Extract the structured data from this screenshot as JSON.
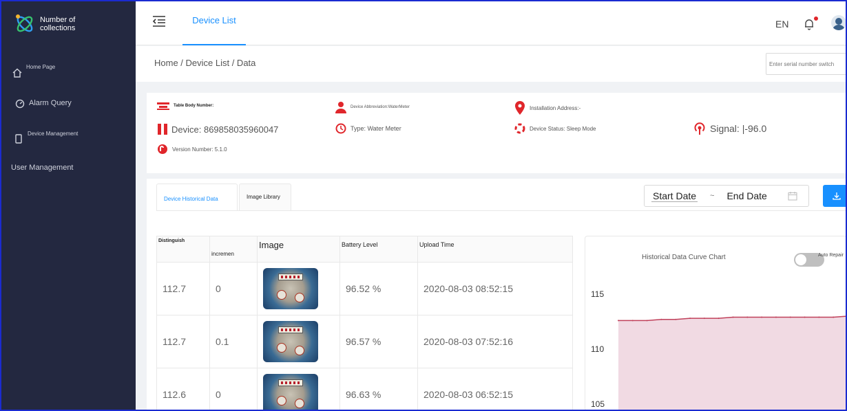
{
  "sidebar": {
    "brand": "Number of collections",
    "items": [
      {
        "label": "Home Page"
      },
      {
        "label": "Alarm Query"
      },
      {
        "label": "Device Management"
      },
      {
        "label": "User Management"
      }
    ]
  },
  "header": {
    "tab": "Device List",
    "lang": "EN"
  },
  "breadcrumb": "Home / Device List / Data",
  "serial_input": {
    "placeholder": "Enter serial number switch"
  },
  "info": {
    "table_body_number": "Table Body Number:",
    "device_abbreviation": "Device Abbreviation:WaterMeter",
    "installation_address": "Installation Address:-",
    "device": "Device: 869858035960047",
    "type": "Type: Water Meter",
    "device_status": "Device Status: Sleep Mode",
    "signal": "Signal: |-96.0",
    "version": "Version Number: 5.1.0"
  },
  "tabs": [
    {
      "label": "Device Historical Data",
      "active": true
    },
    {
      "label": "Image Library",
      "active": false
    }
  ],
  "date_range": {
    "start": "Start Date",
    "separator": "~",
    "end": "End Date"
  },
  "table": {
    "columns": [
      "Distinguish",
      "incremen",
      "Image",
      "Battery Level",
      "Upload Time"
    ],
    "rows": [
      {
        "distinguish": "112.7",
        "increment": "0",
        "battery": "96.52 %",
        "time": "2020-08-03 08:52:15"
      },
      {
        "distinguish": "112.7",
        "increment": "0.1",
        "battery": "96.57 %",
        "time": "2020-08-03 07:52:16"
      },
      {
        "distinguish": "112.6",
        "increment": "0",
        "battery": "96.63 %",
        "time": "2020-08-03 06:52:15"
      }
    ]
  },
  "chart": {
    "title": "Historical Data Curve Chart",
    "toggle_label": "Auto Repair",
    "toggle_on": false
  },
  "chart_data": {
    "type": "area",
    "title": "Historical Data Curve Chart",
    "xlabel": "",
    "ylabel": "",
    "y_ticks": [
      115,
      110,
      105
    ],
    "ylim": [
      104.3,
      116.5
    ],
    "values": [
      112.6,
      112.6,
      112.6,
      112.7,
      112.7,
      112.8,
      112.8,
      112.8,
      112.9,
      112.9,
      112.9,
      112.9,
      112.9,
      112.9,
      112.9,
      112.9,
      113.0
    ],
    "colors": {
      "line": "#c0405a",
      "fill": "#f1dae3"
    }
  },
  "colors": {
    "sidebar_bg": "#232840",
    "accent": "#1890ff",
    "icon_red": "#e0262b"
  }
}
